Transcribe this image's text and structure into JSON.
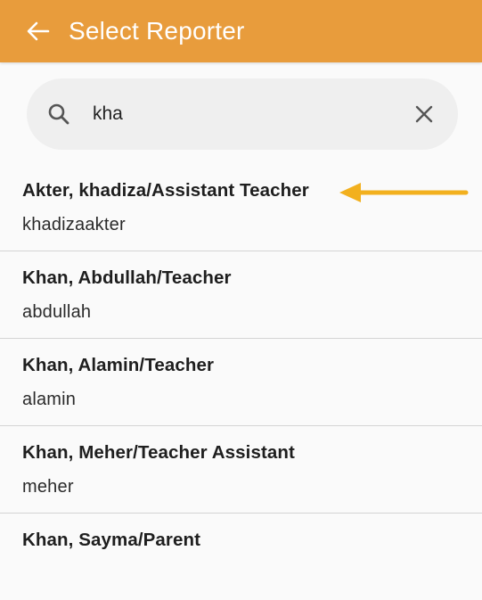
{
  "app_bar": {
    "title": "Select Reporter",
    "back_icon": "arrow-left-icon"
  },
  "search": {
    "value": "kha",
    "placeholder": "",
    "search_icon": "search-icon",
    "clear_icon": "close-icon"
  },
  "results": [
    {
      "name": "Akter, khadiza/Assistant Teacher",
      "username": "khadizaakter"
    },
    {
      "name": "Khan, Abdullah/Teacher",
      "username": "abdullah"
    },
    {
      "name": "Khan, Alamin/Teacher",
      "username": "alamin"
    },
    {
      "name": "Khan, Meher/Teacher Assistant",
      "username": "meher"
    },
    {
      "name": "Khan, Sayma/Parent",
      "username": ""
    }
  ],
  "annotation": {
    "icon": "arrow-pointer-icon",
    "color": "#F2B01E"
  },
  "colors": {
    "accent": "#E89C3C",
    "background": "#FAFAFA",
    "search_bg": "#EFEFEF"
  }
}
